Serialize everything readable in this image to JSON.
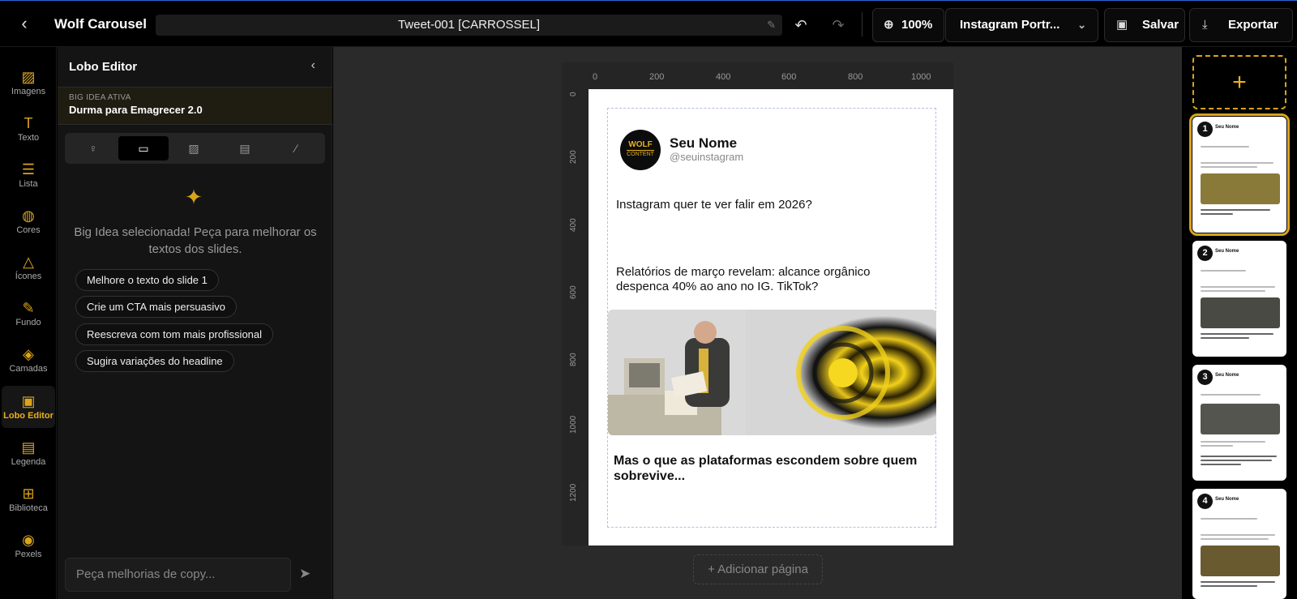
{
  "app": {
    "name": "Wolf Carousel",
    "doc_title": "Tweet-001 [CARROSSEL]"
  },
  "toolbar": {
    "zoom": "100%",
    "format": "Instagram Portr...",
    "save_label": "Salvar",
    "export_label": "Exportar"
  },
  "rail": {
    "items": [
      {
        "label": "Imagens",
        "icon": "image-icon"
      },
      {
        "label": "Texto",
        "icon": "text-icon"
      },
      {
        "label": "Lista",
        "icon": "list-icon"
      },
      {
        "label": "Cores",
        "icon": "palette-icon"
      },
      {
        "label": "Ícones",
        "icon": "shapes-icon"
      },
      {
        "label": "Fundo",
        "icon": "brush-icon"
      },
      {
        "label": "Camadas",
        "icon": "layers-icon"
      },
      {
        "label": "Lobo Editor",
        "icon": "bot-icon",
        "active": true
      },
      {
        "label": "Legenda",
        "icon": "document-icon"
      },
      {
        "label": "Biblioteca",
        "icon": "bookmark-icon"
      },
      {
        "label": "Pexels",
        "icon": "camera-icon"
      }
    ]
  },
  "panel": {
    "title": "Lobo Editor",
    "big_idea": {
      "kicker": "BIG IDEA ATIVA",
      "value": "Durma para Emagrecer 2.0"
    },
    "hint": "Big Idea selecionada! Peça para melhorar os textos dos slides.",
    "suggestions": [
      "Melhore o texto do slide 1",
      "Crie um CTA mais persuasivo",
      "Reescreva com tom mais profissional",
      "Sugira variações do headline"
    ],
    "chat_placeholder": "Peça melhorias de copy..."
  },
  "ruler": {
    "unit": "px",
    "h_ticks": [
      "0",
      "200",
      "400",
      "600",
      "800",
      "1000"
    ],
    "v_ticks": [
      "0",
      "200",
      "400",
      "600",
      "800",
      "1000",
      "1200"
    ]
  },
  "slide": {
    "author": "Seu Nome",
    "handle": "@seuinstagram",
    "logo_text": "WOLF",
    "logo_sub": "CONTENT",
    "text1": "Instagram quer te ver falir em 2026?",
    "text2": "Relatórios de março revelam: alcance orgânico despenca 40% ao ano no IG. TikTok?",
    "text3": "Mas o que as plataformas escondem sobre quem sobrevive..."
  },
  "add_page_label": "+ Adicionar página",
  "thumbnails": [
    {
      "number": "1",
      "name": "Seu Nome",
      "selected": true
    },
    {
      "number": "2",
      "name": "Seu Nome"
    },
    {
      "number": "3",
      "name": "Seu Nome"
    },
    {
      "number": "4",
      "name": "Seu Nome"
    }
  ]
}
